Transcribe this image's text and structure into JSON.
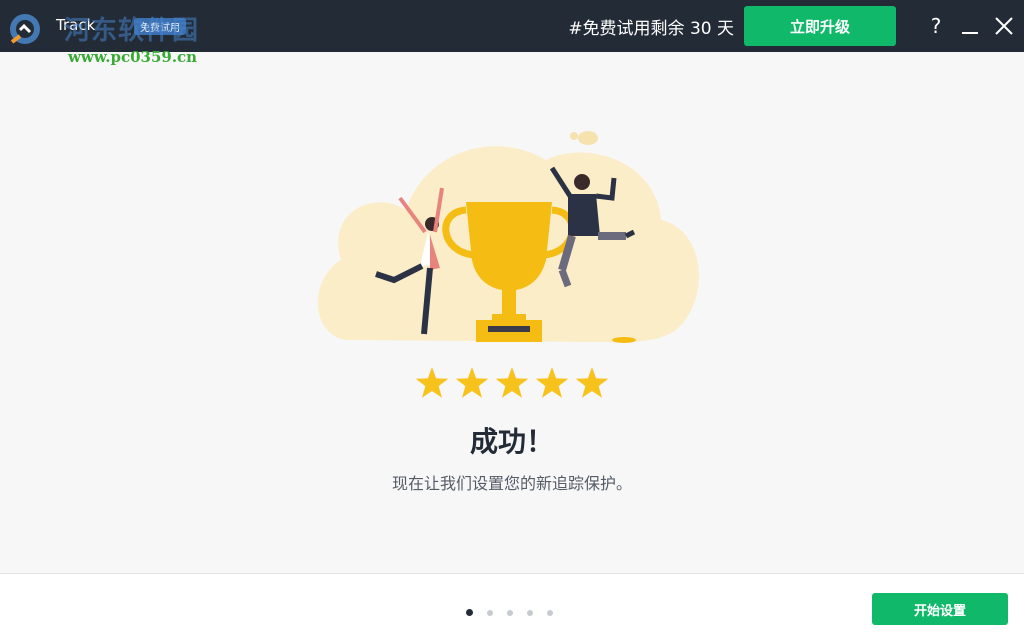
{
  "titlebar": {
    "app_name": "Track",
    "trial_badge": "免费试用",
    "trial_remaining": "#免费试用剩余 30 天",
    "upgrade_label": "立即升级",
    "help_label": "?",
    "minimize_label": "—",
    "close_label": "✕"
  },
  "watermark": {
    "title": "河东软件园",
    "url": "www.pc0359.cn"
  },
  "main": {
    "rating_stars": 5,
    "title": "成功！",
    "subtitle": "现在让我们设置您的新追踪保护。"
  },
  "footer": {
    "pages_total": 5,
    "current_page": 1,
    "start_label": "开始设置"
  },
  "colors": {
    "titlebar_bg": "#232b36",
    "accent_green": "#10b86a",
    "star_yellow": "#f7c21b",
    "trophy_yellow": "#f5bd14",
    "cloud_bg": "#fbedc8"
  }
}
